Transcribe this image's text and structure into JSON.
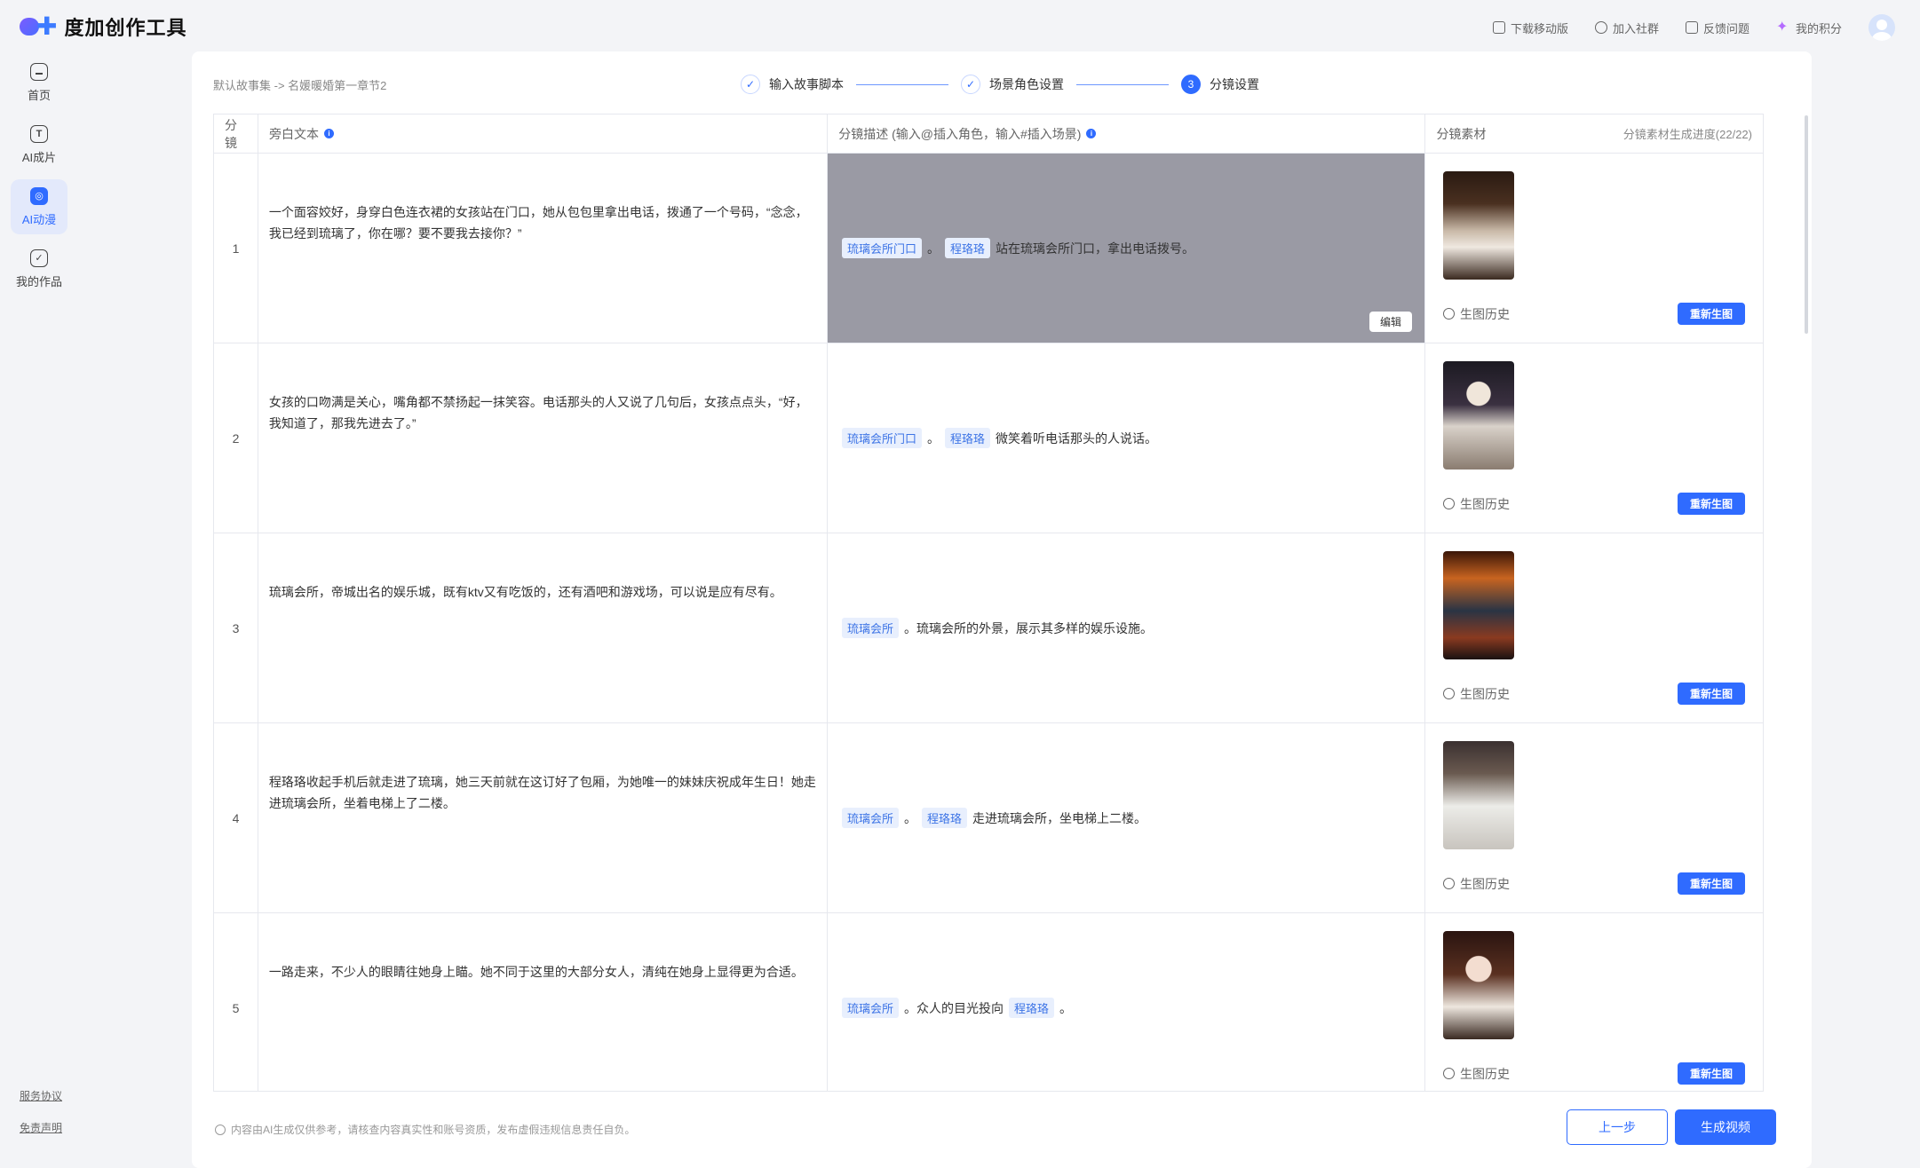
{
  "app": {
    "name": "度加创作工具"
  },
  "top_actions": [
    {
      "label": "下载移动版",
      "icon": "phone-icon"
    },
    {
      "label": "加入社群",
      "icon": "chat-icon"
    },
    {
      "label": "反馈问题",
      "icon": "edit-icon"
    },
    {
      "label": "我的积分",
      "icon": "sparkle-icon"
    }
  ],
  "sidebar": {
    "items": [
      {
        "label": "首页",
        "icon": "home-icon",
        "glyph": ""
      },
      {
        "label": "AI成片",
        "icon": "text-icon",
        "glyph": "T"
      },
      {
        "label": "AI动漫",
        "icon": "anime-icon",
        "glyph": "◎",
        "active": true
      },
      {
        "label": "我的作品",
        "icon": "check-icon",
        "glyph": "✓"
      }
    ],
    "footer_links": [
      "服务协议",
      "免责声明"
    ]
  },
  "breadcrumb": "默认故事集  ->  名媛暖婚第一章节2",
  "steps": [
    {
      "label": "输入故事脚本",
      "marker": "✓"
    },
    {
      "label": "场景角色设置",
      "marker": "✓"
    },
    {
      "label": "分镜设置",
      "marker": "3"
    }
  ],
  "table": {
    "headers": {
      "shot": "分镜",
      "narration": "旁白文本",
      "description": "分镜描述 (输入@插入角色，输入#插入场景)",
      "asset": "分镜素材",
      "progress": "分镜素材生成进度(22/22)"
    },
    "rows": [
      {
        "index": "1",
        "narration": "一个面容姣好，身穿白色连衣裙的女孩站在门口，她从包包里拿出电话，拨通了一个号码，“念念，我已经到琉璃了，你在哪？要不要我去接你？”",
        "description": [
          {
            "tag": "琉璃会所门口"
          },
          {
            "text": "。"
          },
          {
            "tag": "程珞珞"
          },
          {
            "text": "站在琉璃会所门口，拿出电话拨号。"
          }
        ],
        "highlight": true,
        "edit_label": "编辑"
      },
      {
        "index": "2",
        "narration": "女孩的口吻满是关心，嘴角都不禁扬起一抹笑容。电话那头的人又说了几句后，女孩点点头，“好，我知道了，那我先进去了。”",
        "description": [
          {
            "tag": "琉璃会所门口"
          },
          {
            "text": "。"
          },
          {
            "tag": "程珞珞"
          },
          {
            "text": "微笑着听电话那头的人说话。"
          }
        ]
      },
      {
        "index": "3",
        "narration": "琉璃会所，帝城出名的娱乐城，既有ktv又有吃饭的，还有酒吧和游戏场，可以说是应有尽有。",
        "description": [
          {
            "tag": "琉璃会所"
          },
          {
            "text": "。琉璃会所的外景，展示其多样的娱乐设施。"
          }
        ]
      },
      {
        "index": "4",
        "narration": "程珞珞收起手机后就走进了琉璃，她三天前就在这订好了包厢，为她唯一的妹妹庆祝成年生日！她走进琉璃会所，坐着电梯上了二楼。",
        "description": [
          {
            "tag": "琉璃会所"
          },
          {
            "text": "。"
          },
          {
            "tag": "程珞珞"
          },
          {
            "text": "走进琉璃会所，坐电梯上二楼。"
          }
        ]
      },
      {
        "index": "5",
        "narration": "一路走来，不少人的眼睛往她身上瞄。她不同于这里的大部分女人，清纯在她身上显得更为合适。",
        "description": [
          {
            "tag": "琉璃会所"
          },
          {
            "text": "。众人的目光投向"
          },
          {
            "tag": "程珞珞"
          },
          {
            "text": "。"
          }
        ]
      }
    ],
    "history_label": "生图历史",
    "regen_label": "重新生图"
  },
  "footer": {
    "note": "内容由AI生成仅供参考，请核查内容真实性和账号资质，发布虚假违规信息责任自负。",
    "prev_label": "上一步",
    "generate_label": "生成视频"
  }
}
